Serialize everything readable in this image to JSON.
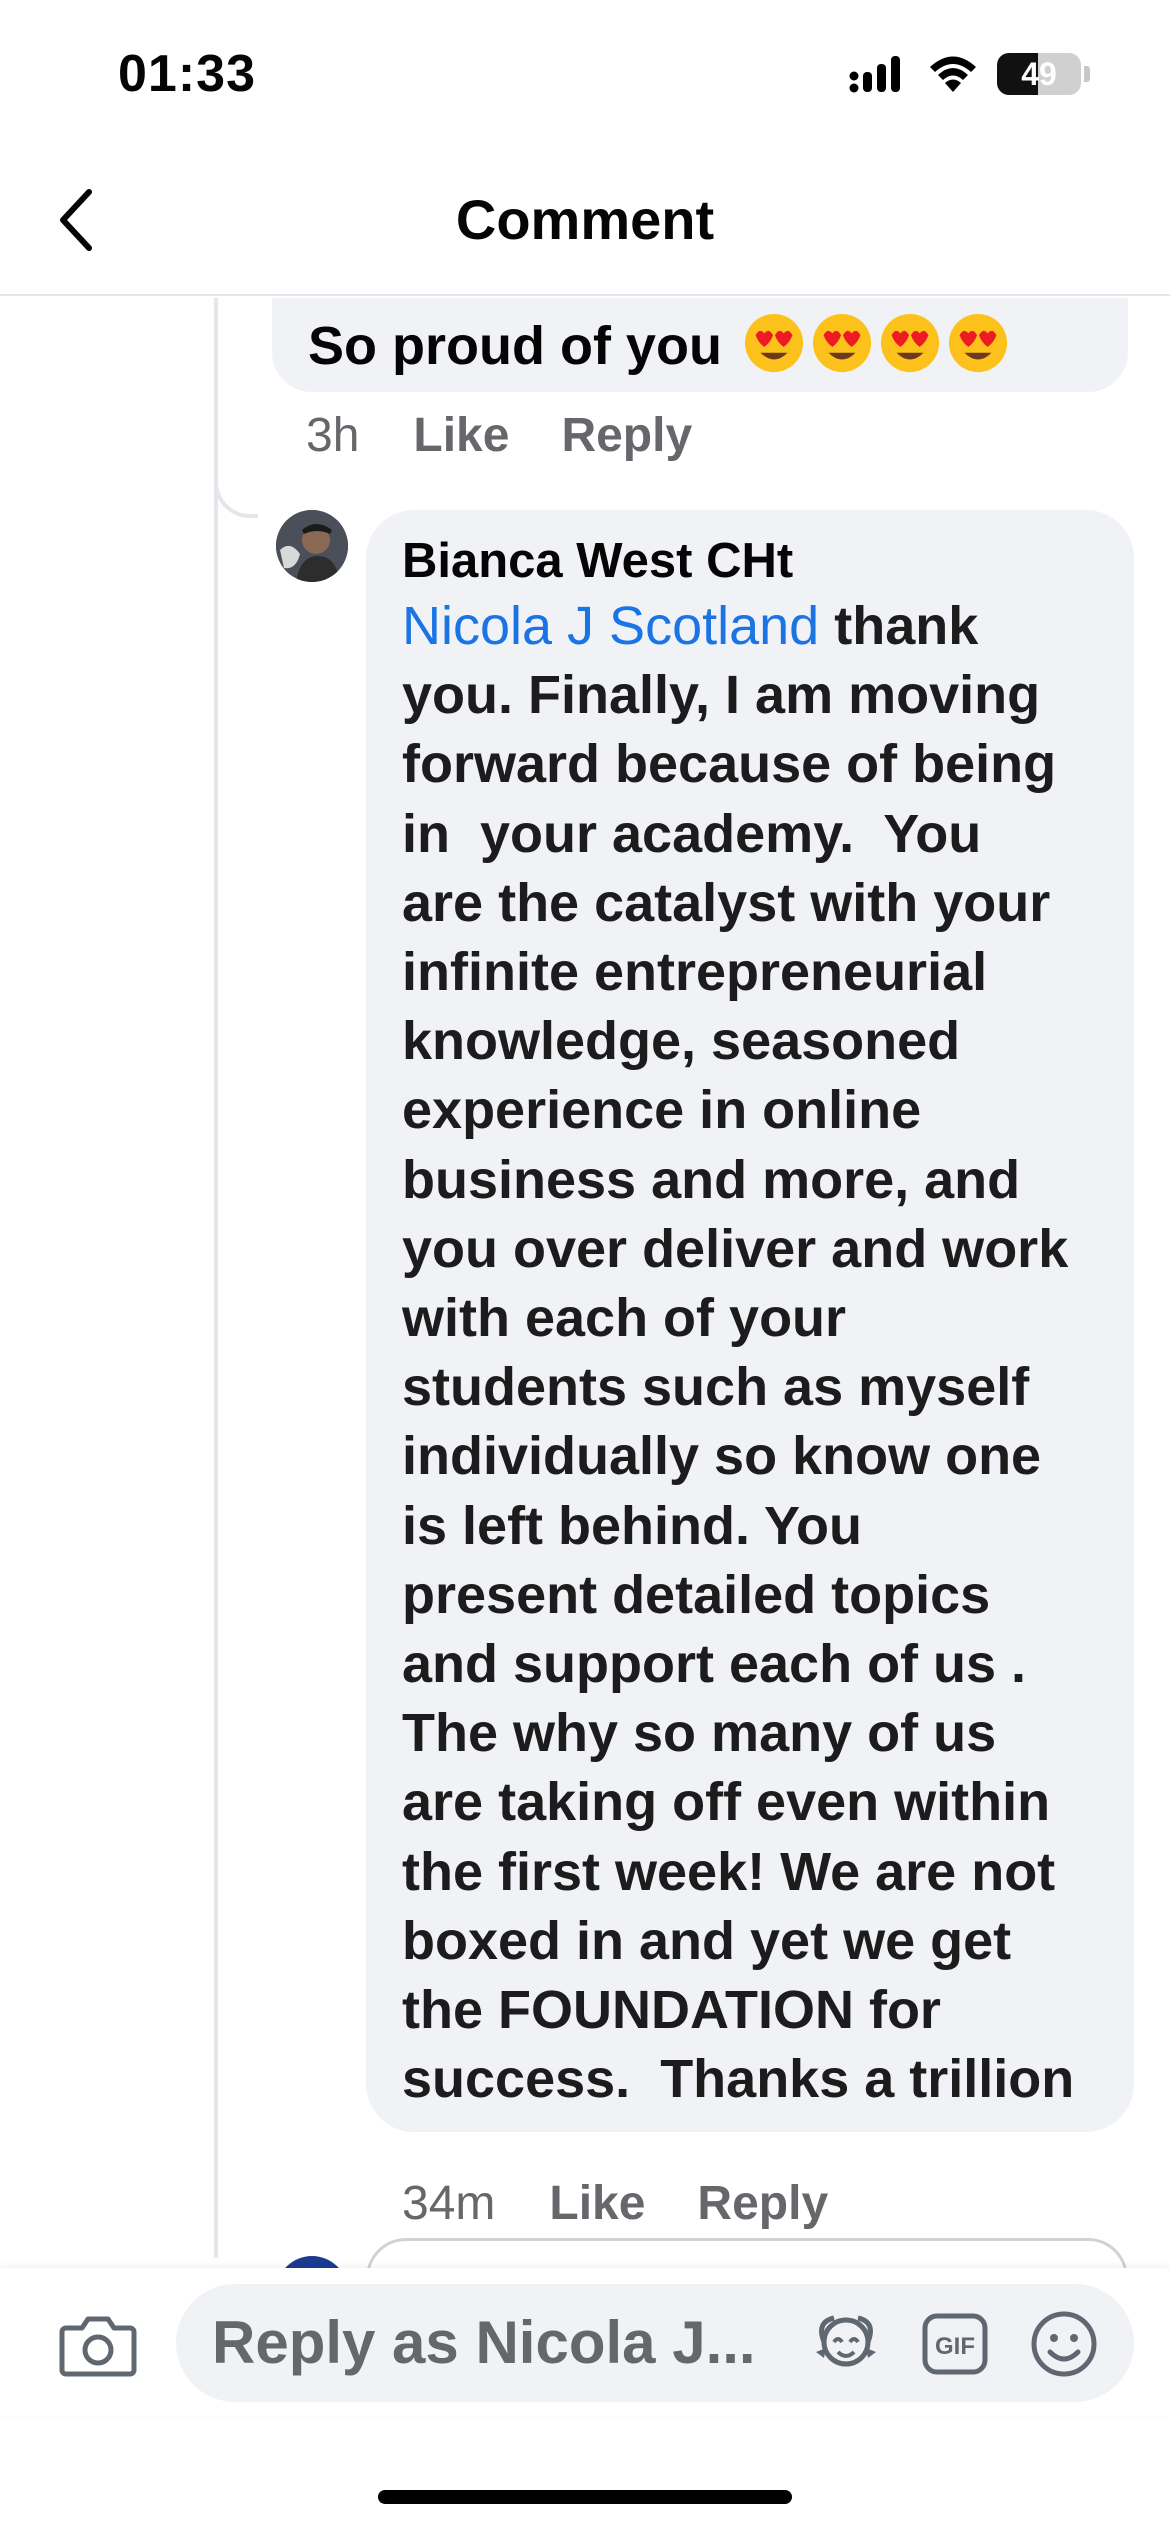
{
  "status_bar": {
    "time": "01:33",
    "battery_level": "49",
    "icons": [
      "signal-icon",
      "wifi-icon",
      "battery-icon"
    ]
  },
  "header": {
    "back_icon": "chevron-left-icon",
    "title": "Comment"
  },
  "thread": {
    "previous_comment": {
      "text": "So proud of you",
      "emojis": [
        "heart-eyes-emoji",
        "heart-eyes-emoji",
        "heart-eyes-emoji",
        "heart-eyes-emoji"
      ],
      "time": "3h",
      "like_label": "Like",
      "reply_label": "Reply"
    },
    "reply": {
      "author": "Bianca West CHt",
      "mention": "Nicola J Scotland",
      "text": " thank\nyou. Finally, I am moving\nforward because of being\nin  your academy.  You\nare the catalyst with your\ninfinite entrepreneurial\nknowledge, seasoned\nexperience in online\nbusiness and more, and\nyou over deliver and work\nwith each of your\nstudents such as myself\nindividually so know one\nis left behind. You\npresent detailed topics\nand support each of us .\nThe why so many of us\nare taking off even within\nthe first week! We are not\nboxed in and yet we get\nthe FOUNDATION for\nsuccess.  Thanks a trillion",
      "time": "34m",
      "like_label": "Like",
      "reply_label": "Reply"
    }
  },
  "composer": {
    "placeholder": "Reply as Nicola J...",
    "icons": [
      "camera-icon",
      "avatar-frame-icon",
      "gif-icon",
      "emoji-icon"
    ],
    "gif_label": "GIF"
  },
  "colors": {
    "bubble": "#f0f2f5",
    "mention": "#1b74e4",
    "meta": "#65676b"
  }
}
